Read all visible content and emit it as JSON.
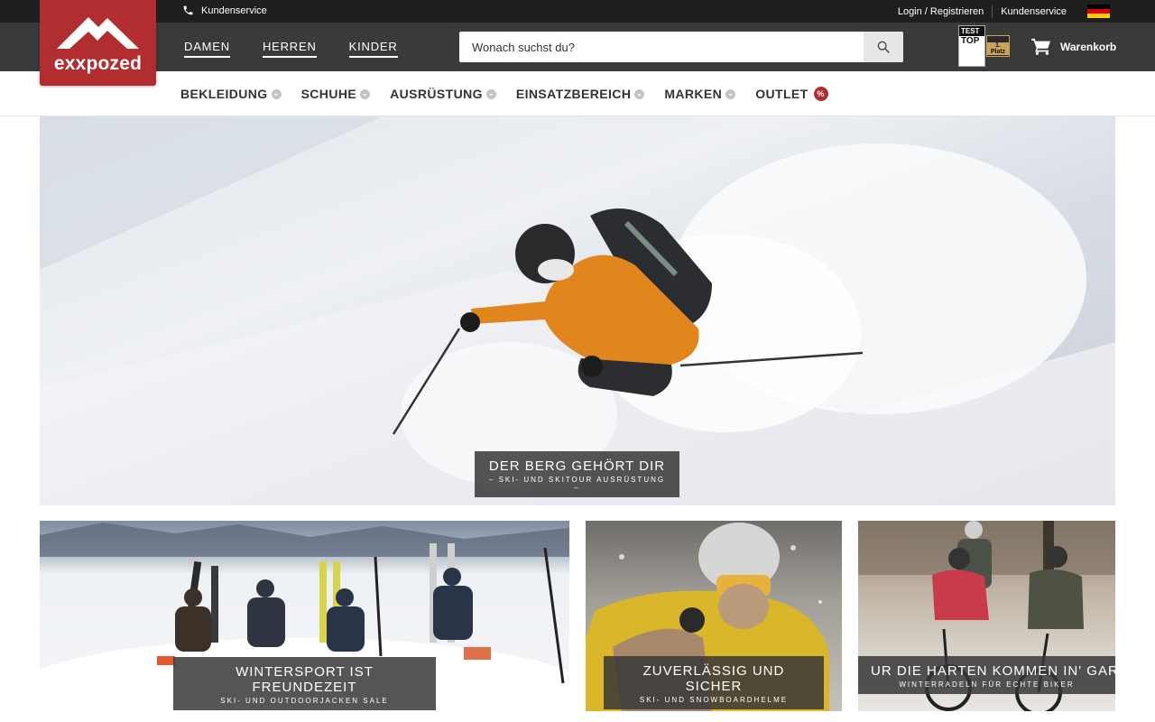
{
  "topbar": {
    "service_label": "Kundenservice",
    "login_label": "Login / Registrieren",
    "service_link_label": "Kundenservice"
  },
  "brand": {
    "name": "exxpozed",
    "color": "#b22d2f"
  },
  "gender_nav": [
    {
      "label": "DAMEN"
    },
    {
      "label": "HERREN"
    },
    {
      "label": "KINDER"
    }
  ],
  "search": {
    "placeholder": "Wonach suchst du?"
  },
  "cart": {
    "label": "Warenkorb"
  },
  "seal": {
    "line1": "TEST",
    "line2": "TOP",
    "badge": "1. Platz"
  },
  "category_nav": [
    {
      "label": "BEKLEIDUNG"
    },
    {
      "label": "SCHUHE"
    },
    {
      "label": "AUSRÜSTUNG"
    },
    {
      "label": "EINSATZBEREICH"
    },
    {
      "label": "MARKEN"
    },
    {
      "label": "OUTLET",
      "badge": "%"
    }
  ],
  "hero": {
    "title": "DER BERG GEHÖRT DIR",
    "subtitle": "– SKI- UND SKITOUR AUSRÜSTUNG –"
  },
  "tiles": [
    {
      "title": "WINTERSPORT IST FREUNDEZEIT",
      "subtitle": "SKI- UND OUTDOORJACKEN SALE"
    },
    {
      "title": "ZUVERLÄSSIG UND SICHER",
      "subtitle": "SKI- UND SNOWBOARDHELME"
    },
    {
      "title": "UR DIE HARTEN KOMMEN IN' GARTE",
      "subtitle": "WINTERRADELN FÜR ECHTE BIKER"
    }
  ]
}
